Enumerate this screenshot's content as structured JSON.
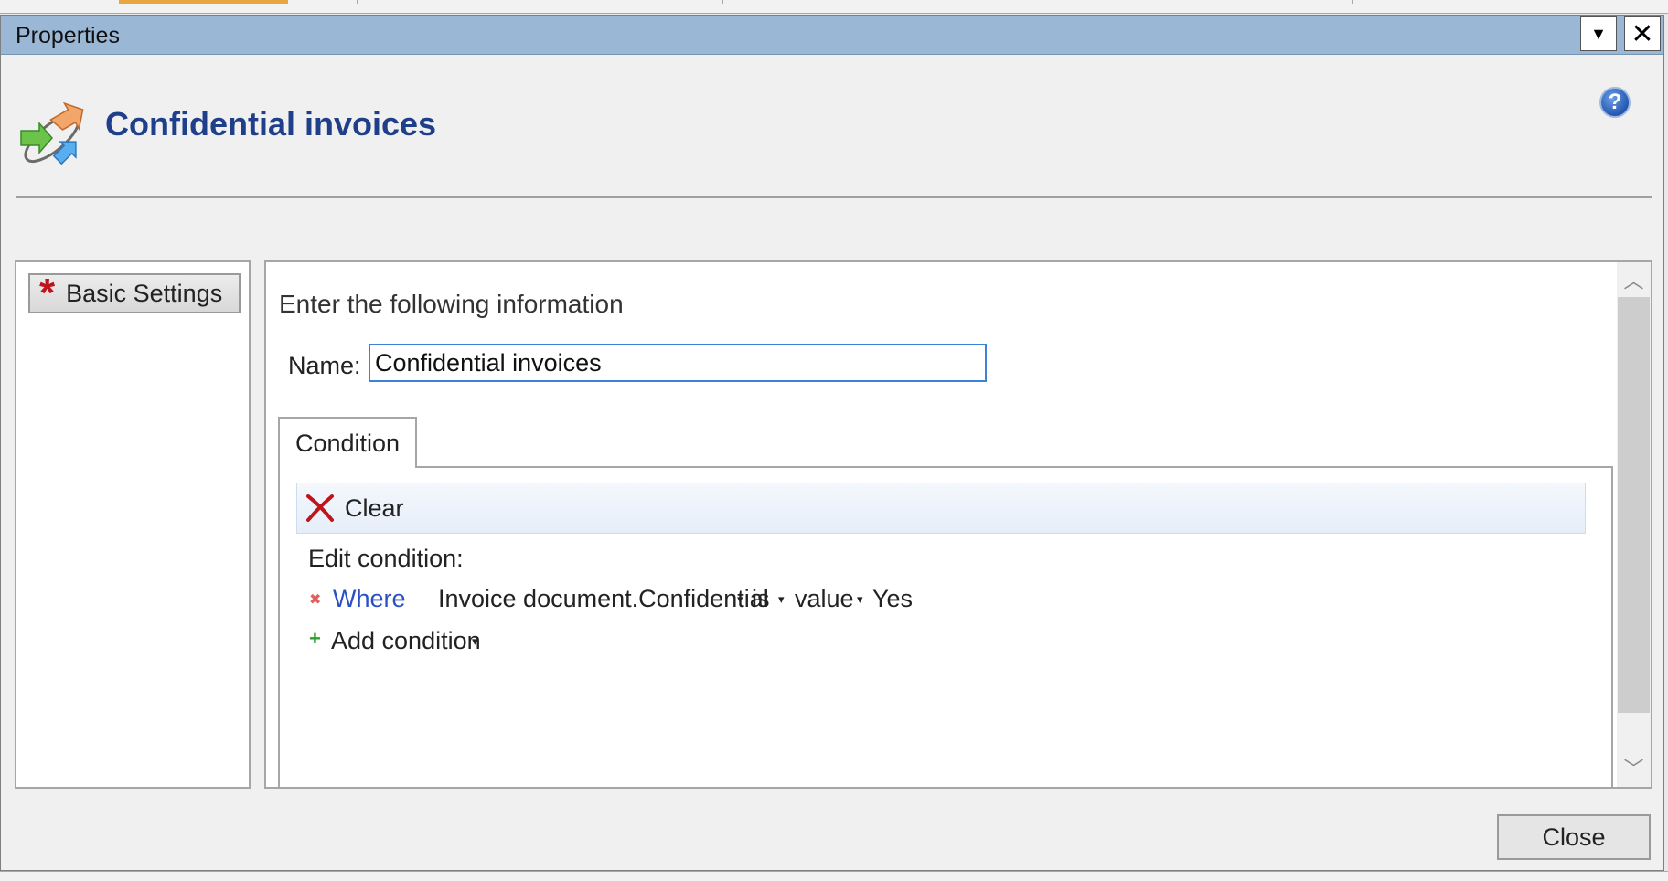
{
  "window": {
    "title": "Properties",
    "menu_icon": "dropdown-arrow-icon",
    "close_icon": "close-icon",
    "close_glyph": "✕",
    "menu_glyph": "▼"
  },
  "header": {
    "title": "Confidential invoices",
    "icon": "workflow-rule-icon",
    "help_icon": "help-icon",
    "help_glyph": "?"
  },
  "sidebar": {
    "items": [
      {
        "label": "Basic Settings",
        "icon": "required-star-icon"
      }
    ]
  },
  "form": {
    "intro": "Enter the following information",
    "name_label": "Name:",
    "name_value": "Confidential invoices"
  },
  "condition_tab": {
    "tab_label": "Condition",
    "clear_label": "Clear",
    "edit_label": "Edit condition:",
    "rows": [
      {
        "connector": "Where",
        "field": "Invoice document.Confidential",
        "operator": "is",
        "value_type": "value",
        "value": "Yes"
      }
    ],
    "add_condition_label": "Add condition"
  },
  "footer": {
    "close_label": "Close"
  },
  "colors": {
    "titlebar": "#9ab7d6",
    "heading": "#1f3f8a",
    "link": "#2a51c4",
    "required_star": "#c0141c",
    "input_focus_border": "#3a83d6"
  }
}
